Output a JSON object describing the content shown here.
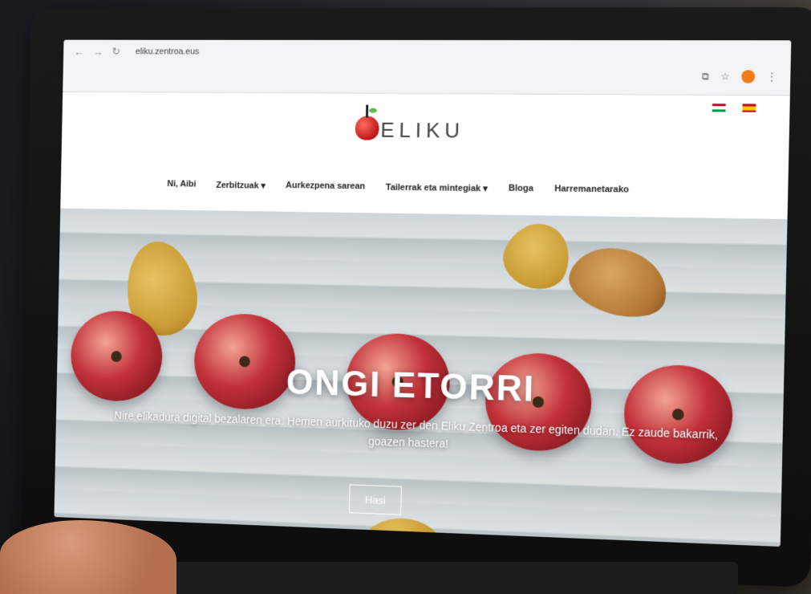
{
  "browser": {
    "back_icon": "arrow-left-icon",
    "forward_icon": "arrow-right-icon",
    "reload_icon": "reload-icon",
    "url": "eliku.zentroa.eus"
  },
  "site": {
    "logo_text": "ELIKU",
    "languages": [
      "eu",
      "es"
    ],
    "nav": [
      {
        "label": "Ni, Aibi"
      },
      {
        "label": "Zerbitzuak",
        "dropdown": true
      },
      {
        "label": "Aurkezpena sarean"
      },
      {
        "label": "Tailerrak eta mintegiak",
        "dropdown": true
      },
      {
        "label": "Bloga"
      },
      {
        "label": "Harremanetarako"
      }
    ]
  },
  "hero": {
    "title": "ONGI ETORRI",
    "text": "Nire elikadura digital bezalaren era. Hemen aurkituko duzu zer den Eliku Zentroa eta zer egiten dudan. Ez zaude bakarrik, goazen hastera!",
    "button": "Hasi"
  },
  "colors": {
    "accent_orange": "#ef7d16",
    "apple_red": "#c0171b",
    "leaf_green": "#5cb84a"
  }
}
